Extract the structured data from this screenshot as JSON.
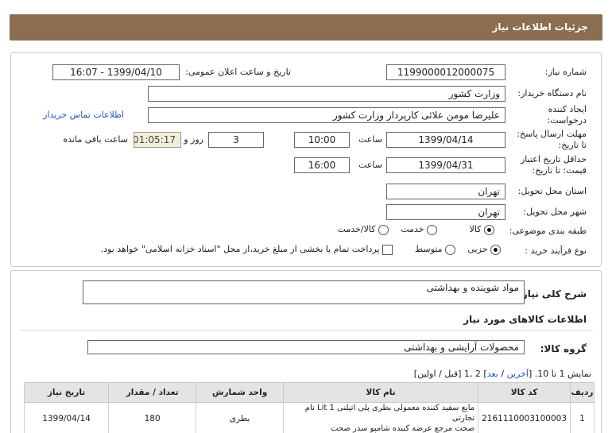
{
  "header": {
    "title": "جزئیات اطلاعات نیاز"
  },
  "form": {
    "need_number_label": "شماره نیاز:",
    "need_number": "1199000012000075",
    "announce_label": "تاریخ و ساعت اعلان عمومی:",
    "announce_value": "1399/04/10 - 16:07",
    "buyer_org_label": "نام دستگاه خریدار:",
    "buyer_org": "وزارت کشور",
    "requester_label_1": "ایجاد کننده",
    "requester_label_2": "درخواست:",
    "requester": "علیرضا مومن علائی کارپرداز وزارت کشور",
    "contact_link": "اطلاعات تماس خریدار",
    "send_deadline_label_1": "مهلت ارسال پاسخ:",
    "send_deadline_label_2": "تا تاریخ:",
    "send_date": "1399/04/14",
    "time_label": "ساعت",
    "send_time": "10:00",
    "days": "3",
    "days_label": "روز و",
    "remaining_time": "01:05:17",
    "remaining_label": "ساعت باقی مانده",
    "validity_label_1": "حداقل تاریخ اعتبار",
    "validity_label_2": "قیمت: تا تاریخ:",
    "validity_date": "1399/04/31",
    "validity_time": "16:00",
    "province_label": "استان محل تحویل:",
    "province": "تهران",
    "city_label": "شهر محل تحویل:",
    "city": "تهران",
    "category_label": "طبقه بندی موضوعی:",
    "category_options": [
      "کالا",
      "خدمت",
      "کالا/خدمت"
    ],
    "category_selected": "کالا",
    "process_label": "نوع فرآیند خرید :",
    "process_options": [
      "جزیی",
      "متوسط"
    ],
    "process_selected": "جزیی",
    "treasury_text": "پرداخت تمام یا بخشی از مبلغ خرید،از محل \"اسناد خزانه اسلامی\" خواهد بود."
  },
  "details": {
    "summary_label": "شرح کلی نیاز:",
    "summary": "مواد شوینده و بهداشتی",
    "goods_info_title": "اطلاعات کالاهای مورد نیاز",
    "group_label": "گروه کالا:",
    "group_value": "محصولات آرایشی و بهداشتی",
    "paging": {
      "prefix": "نمایش 1 تا 10. [",
      "last": "آخرین",
      "sep1": " / ",
      "next": "بعد",
      "pages": "] 2 ,1 [قبل / اولین]"
    }
  },
  "table": {
    "columns": [
      "ردیف",
      "کد کالا",
      "نام کالا",
      "واحد شمارش",
      "تعداد / مقدار",
      "تاریخ نیاز"
    ],
    "rows": [
      {
        "row": "1",
        "code": "2161110003100003",
        "name_line1": "مایع سفید کننده معمولی بطری پلی اتیلنی 1 Lit نام تجارتی",
        "name_line2": "صحت مرجع عرضه کننده شامپو سدر صحت",
        "unit": "بطری",
        "qty": "180",
        "date": "1399/04/14"
      }
    ]
  }
}
